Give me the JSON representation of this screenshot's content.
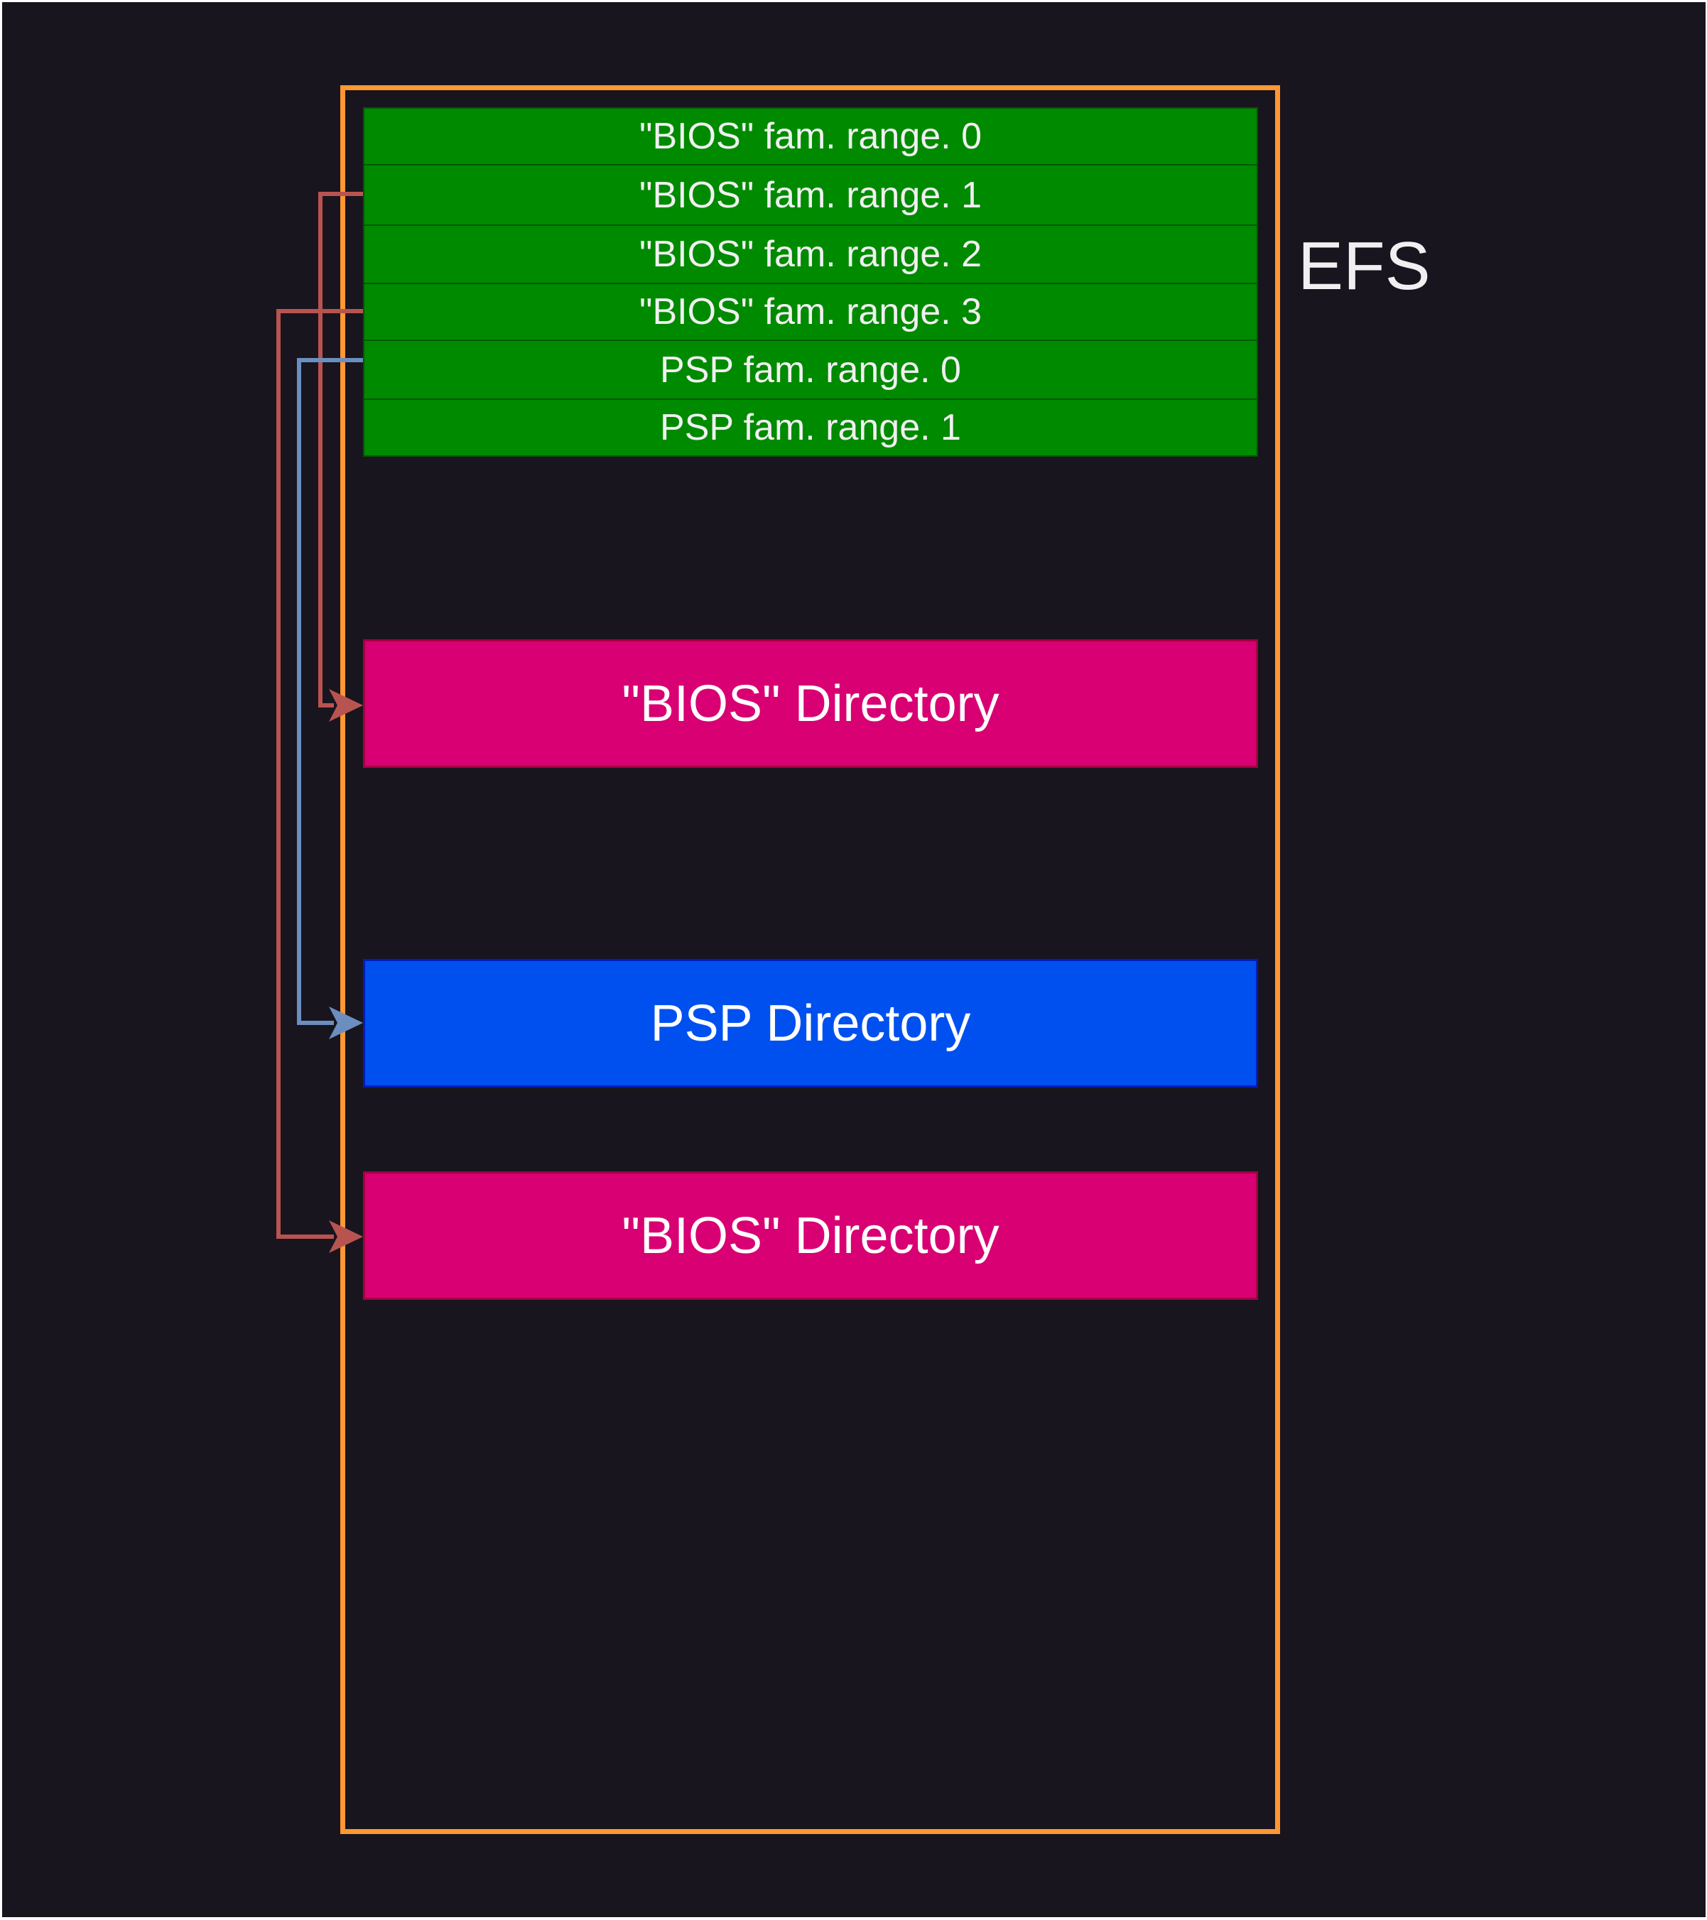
{
  "efs": {
    "label": "EFS"
  },
  "ranges": [
    {
      "label": "\"BIOS\" fam. range. 0"
    },
    {
      "label": "\"BIOS\" fam. range. 1"
    },
    {
      "label": "\"BIOS\" fam. range. 2"
    },
    {
      "label": "\"BIOS\" fam. range. 3"
    },
    {
      "label": "PSP fam. range. 0"
    },
    {
      "label": "PSP fam. range. 1"
    }
  ],
  "directories": [
    {
      "label": "\"BIOS\" Directory",
      "kind": "bios"
    },
    {
      "label": "PSP Directory",
      "kind": "psp"
    },
    {
      "label": "\"BIOS\" Directory",
      "kind": "bios"
    }
  ],
  "connections": [
    {
      "from": "\"BIOS\" fam. range. 1",
      "to": "\"BIOS\" Directory (first)",
      "color": "#b85450"
    },
    {
      "from": "\"BIOS\" fam. range. 3",
      "to": "\"BIOS\" Directory (second)",
      "color": "#b85450"
    },
    {
      "from": "PSP fam. range. 0",
      "to": "PSP Directory",
      "color": "#6c8ebf"
    }
  ],
  "colors": {
    "background": "#18151f",
    "efs_border": "#ff9733",
    "range_fill": "#008a00",
    "bios_directory_fill": "#d80073",
    "psp_directory_fill": "#0050ef",
    "bios_arrow": "#b85450",
    "psp_arrow": "#6c8ebf"
  }
}
